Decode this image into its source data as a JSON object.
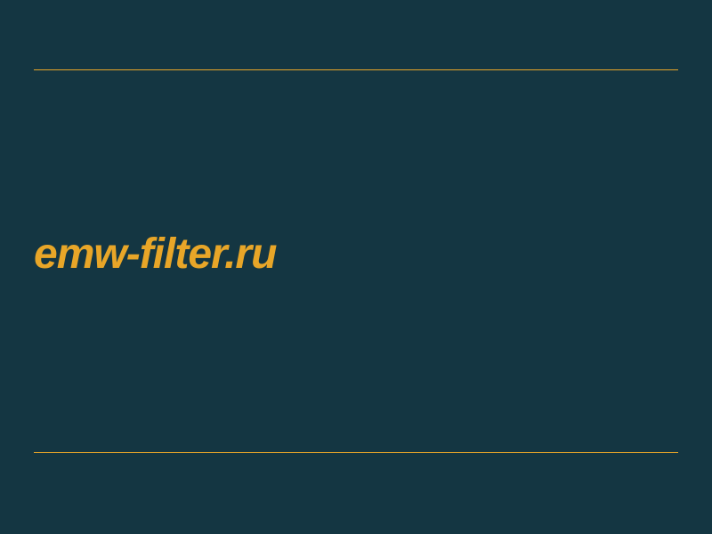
{
  "domain_name": "emw-filter.ru",
  "colors": {
    "background": "#143642",
    "accent": "#e8a628"
  }
}
